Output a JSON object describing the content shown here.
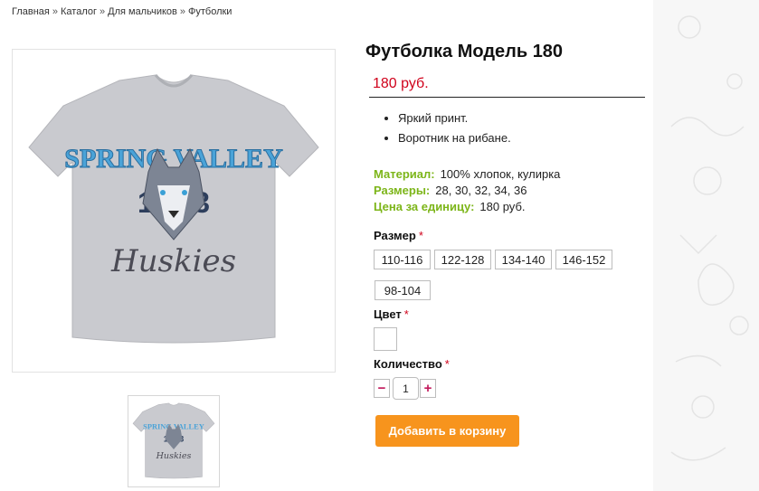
{
  "breadcrumb": {
    "items": [
      "Главная",
      "Каталог",
      "Для мальчиков",
      "Футболки"
    ],
    "separator": "»"
  },
  "product": {
    "title": "Футболка Модель 180",
    "price": "180 руб.",
    "image_alt_text": {
      "main_line1": "SPRING VALLEY",
      "main_number": "18   03",
      "main_word": "Huskies"
    },
    "features": [
      "Яркий принт.",
      "Воротник на рибане."
    ],
    "properties": [
      {
        "key": "Материал:",
        "value": "100% хлопок, кулирка"
      },
      {
        "key": "Размеры:",
        "value": "28, 30, 32, 34, 36"
      },
      {
        "key": "Цена за единицу:",
        "value": "180 руб."
      }
    ]
  },
  "options": {
    "size_label": "Размер",
    "sizes": [
      "110-116",
      "122-128",
      "134-140",
      "146-152",
      "98-104"
    ],
    "color_label": "Цвет",
    "quantity_label": "Количество",
    "required_mark": "*",
    "quantity_value": "1",
    "minus": "−",
    "plus": "+"
  },
  "cart": {
    "add_button": "Добавить в корзину"
  },
  "colors": {
    "price": "#d0021b",
    "property_key": "#7cb518",
    "cart_button": "#f7941d",
    "shirt": "#c9cacf"
  }
}
